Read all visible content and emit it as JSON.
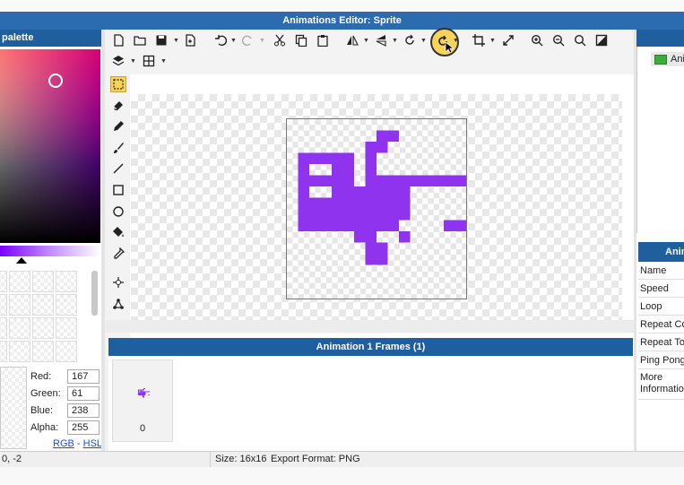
{
  "window": {
    "title": "Animations Editor: Sprite"
  },
  "palette": {
    "header": "palette",
    "red_label": "Red:",
    "red": "167",
    "green_label": "Green:",
    "green": "61",
    "blue_label": "Blue:",
    "blue": "238",
    "alpha_label": "Alpha:",
    "alpha": "255",
    "mode_rgb": "RGB",
    "mode_sep": " - ",
    "mode_hsl": "HSL",
    "current_color": "#a73dee"
  },
  "toolbar": {
    "icons": [
      "new-file-icon",
      "open-folder-icon",
      "save-icon",
      "export-icon",
      "undo-icon",
      "redo-icon",
      "cut-icon",
      "copy-icon",
      "paste-icon",
      "flip-horizontal-icon",
      "flip-vertical-icon",
      "rotate-icon",
      "rotate-highlighted-icon",
      "crop-icon",
      "resize-icon",
      "zoom-in-icon",
      "zoom-out-icon",
      "zoom-fit-icon",
      "fill-screen-icon",
      "layers-icon",
      "grid-icon"
    ]
  },
  "tools": [
    "select",
    "eraser",
    "pencil",
    "brush",
    "line",
    "rectangle",
    "ellipse",
    "fill",
    "eyedropper",
    "anchor",
    "node"
  ],
  "sprite": {
    "color": "#9033ee",
    "size": 16,
    "pixels": [
      "................",
      "........##......",
      ".......##.......",
      ".#####.#........",
      ".#..##.#........",
      ".#####.#########",
      ".#..#######.....",
      ".##########.....",
      ".##########.....",
      ".#########....##",
      "......##..#.....",
      ".......##.......",
      ".......##.......",
      "................",
      "................",
      "................"
    ]
  },
  "frames": {
    "header": "Animation 1 Frames (1)",
    "frame_number": "0"
  },
  "animations": {
    "item": "Ani"
  },
  "properties": {
    "header": "Anim",
    "rows": [
      "Name",
      "Speed",
      "Loop",
      "Repeat Co",
      "Repeat To",
      "Ping Pong",
      "More\nInformatio"
    ]
  },
  "status": {
    "coords": "0, -2",
    "size": "Size: 16x16",
    "export": "Export Format: PNG"
  }
}
